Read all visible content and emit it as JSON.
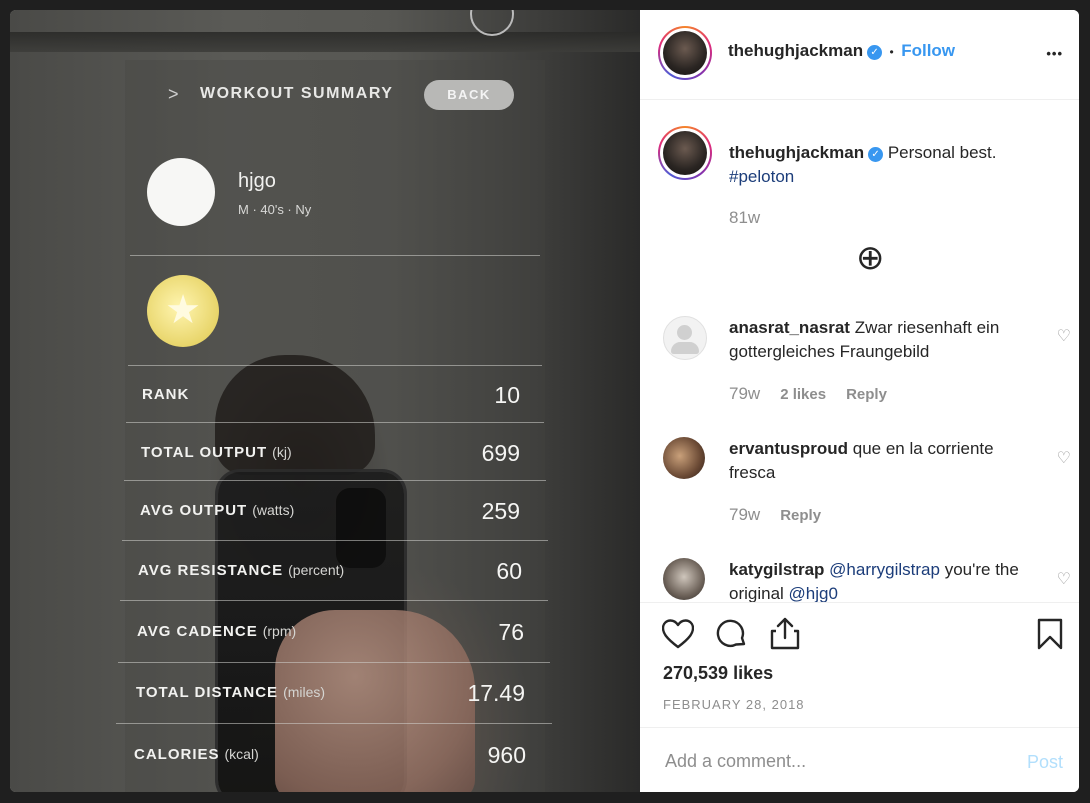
{
  "photo": {
    "workout_title": "WORKOUT SUMMARY",
    "chevron": ">",
    "back_label": "BACK",
    "rider_name": "hjgo",
    "rider_meta": "M · 40's · Ny",
    "star_glyph": "★",
    "stats": [
      {
        "label": "RANK",
        "unit": "",
        "value": "10"
      },
      {
        "label": "TOTAL OUTPUT",
        "unit": "(kj)",
        "value": "699"
      },
      {
        "label": "AVG OUTPUT",
        "unit": "(watts)",
        "value": "259"
      },
      {
        "label": "AVG RESISTANCE",
        "unit": "(percent)",
        "value": "60"
      },
      {
        "label": "AVG CADENCE",
        "unit": "(rpm)",
        "value": "76"
      },
      {
        "label": "TOTAL DISTANCE",
        "unit": "(miles)",
        "value": "17.49"
      },
      {
        "label": "CALORIES",
        "unit": "(kcal)",
        "value": "960"
      }
    ]
  },
  "header": {
    "username": "thehughjackman",
    "verified_glyph": "✓",
    "separator": "•",
    "follow_label": "Follow",
    "more_label": "•••"
  },
  "caption": {
    "username": "thehughjackman",
    "text": "Personal best.",
    "hashtag": "#peloton",
    "time": "81w",
    "load_more_glyph": "⊕"
  },
  "comments": [
    {
      "username": "anasrat_nasrat",
      "text": "Zwar riesenhaft ein gottergleiches Fraungebild",
      "mention": "",
      "text2": "",
      "mention2": "",
      "time": "79w",
      "likes": "2 likes",
      "reply": "Reply"
    },
    {
      "username": "ervantusproud",
      "text": "que en la corriente fresca",
      "mention": "",
      "text2": "",
      "mention2": "",
      "time": "79w",
      "likes": "",
      "reply": "Reply"
    },
    {
      "username": "katygilstrap",
      "text": "",
      "mention": "@harrygilstrap",
      "text2": "you're the original",
      "mention2": "@hjg0",
      "time": "",
      "likes": "",
      "reply": ""
    }
  ],
  "actions": {
    "likes": "270,539 likes",
    "date": "FEBRUARY 28, 2018"
  },
  "add_comment": {
    "placeholder": "Add a comment...",
    "post_label": "Post"
  },
  "colors": {
    "accent": "#3897f0",
    "link": "#1c3d7a",
    "muted": "#8e8e8e"
  }
}
